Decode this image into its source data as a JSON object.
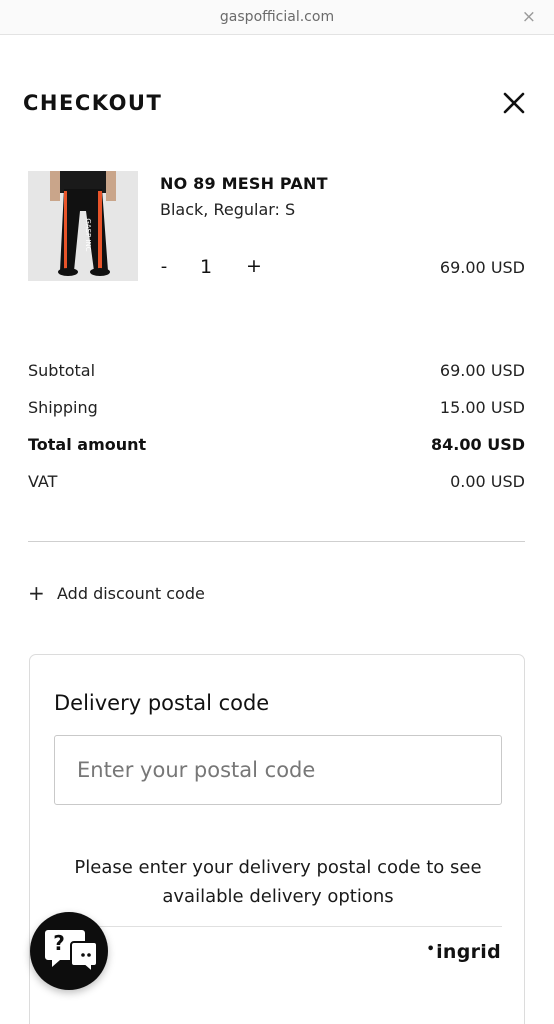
{
  "browser": {
    "url": "gaspofficial.com",
    "close_glyph": "×"
  },
  "checkout": {
    "title": "CHECKOUT",
    "close_icon": "close-icon",
    "item": {
      "name": "NO 89 MESH PANT",
      "variant": "Black, Regular: S",
      "image_alt": "product-image",
      "quantity_minus": "-",
      "quantity": "1",
      "quantity_plus": "+",
      "price": "69.00 USD"
    },
    "summary": {
      "subtotal_label": "Subtotal",
      "subtotal_value": "69.00 USD",
      "shipping_label": "Shipping",
      "shipping_value": "15.00 USD",
      "total_label": "Total amount",
      "total_value": "84.00 USD",
      "vat_label": "VAT",
      "vat_value": "0.00 USD"
    },
    "discount": {
      "plus": "+",
      "label": "Add discount code"
    },
    "delivery": {
      "title": "Delivery postal code",
      "input_placeholder": "Enter your postal code",
      "input_value": "",
      "message": "Please enter your delivery postal code to see available delivery options",
      "provider_dot": "•",
      "provider_name": "ingrid"
    },
    "help_button": {
      "icon": "chat-help-icon"
    }
  },
  "colors": {
    "text": "#111111",
    "muted": "#6b6b6b",
    "border": "#dcdcdc",
    "help_bg": "#0d0d0d",
    "product_accent": "#e8542a"
  }
}
